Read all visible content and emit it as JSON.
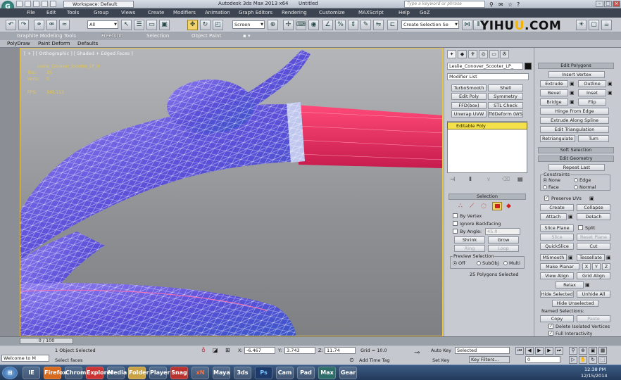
{
  "titlebar": {
    "workspace": "Workspace: Default",
    "app_title": "Autodesk 3ds Max 2013 x64",
    "doc_title": "Untitled",
    "search_placeholder": "Type a keyword or phrase"
  },
  "menubar": {
    "items": [
      "File",
      "Edit",
      "Tools",
      "Group",
      "Views",
      "Create",
      "Modifiers",
      "Animation",
      "Graph Editors",
      "Rendering",
      "Customize",
      "MAXScript",
      "Help",
      "GoZ"
    ]
  },
  "toolbar": {
    "selection_filter": "All",
    "ref_coord": "Screen",
    "named_selection": "Create Selection Se"
  },
  "watermark": {
    "text_a": "YI",
    "text_b": "HU",
    "text_c": "U",
    "text_d": ".COM"
  },
  "ribbon": {
    "tabs": [
      "Graphite Modeling Tools",
      "Freeform",
      "Selection",
      "Object Paint"
    ],
    "sub_tabs": [
      "PolyDraw",
      "Paint Deform",
      "Defaults"
    ]
  },
  "viewport": {
    "label": "[ + ] [ Orthographic ] [ Shaded + Edged Faces ]",
    "stats": {
      "object": "Leslie_Conover_Scooter_LP_H",
      "tris_label": "Tris:",
      "tris": "25",
      "verts_label": "Verts:",
      "verts": "0",
      "fps_label": "FPS:",
      "fps": "345.113"
    }
  },
  "command_panel": {
    "object_name": "Leslie_Conover_Scooter_LP_",
    "modifier_list": "Modifier List",
    "modifier_buttons": [
      "TurboSmooth",
      "Shell",
      "Edit Poly",
      "Symmetry",
      "FFD(box)",
      "STL Check",
      "Unwrap UVW",
      "ffdDeform (WS"
    ],
    "stack_item": "Editable Poly",
    "selection_header": "Selection",
    "by_vertex": "By Vertex",
    "ignore_backfacing": "Ignore Backfacing",
    "by_angle": "By Angle:",
    "angle_value": "45.0",
    "shrink": "Shrink",
    "grow": "Grow",
    "ring": "Ring",
    "loop": "Loop",
    "preview_selection": "Preview Selection",
    "preview_off": "Off",
    "preview_subobj": "SubObj",
    "preview_multi": "Multi",
    "selected_info": "25 Polygons Selected"
  },
  "rollout": {
    "edit_polygons": "Edit Polygons",
    "insert_vertex": "Insert Vertex",
    "extrude": "Extrude",
    "outline": "Outline",
    "bevel": "Bevel",
    "inset": "Inset",
    "bridge": "Bridge",
    "flip": "Flip",
    "hinge_from_edge": "Hinge From Edge",
    "extrude_along_spline": "Extrude Along Spline",
    "edit_triangulation": "Edit Triangulation",
    "retriangulate": "Retriangulate",
    "turn": "Turn",
    "soft_selection": "Soft Selection",
    "edit_geometry": "Edit Geometry",
    "repeat_last": "Repeat Last",
    "constraints": "Constraints",
    "c_none": "None",
    "c_edge": "Edge",
    "c_face": "Face",
    "c_normal": "Normal",
    "preserve_uvs": "Preserve UVs",
    "create": "Create",
    "collapse": "Collapse",
    "attach": "Attach",
    "detach": "Detach",
    "slice_plane": "Slice Plane",
    "split": "Split",
    "reset_plane": "Reset Plane",
    "slice": "Slice",
    "quickslice": "QuickSlice",
    "cut": "Cut",
    "msmooth": "MSmooth",
    "tessellate": "Tessellate",
    "make_planar": "Make Planar",
    "x": "X",
    "y": "Y",
    "z": "Z",
    "view_align": "View Align",
    "grid_align": "Grid Align",
    "relax": "Relax",
    "hide_selected": "Hide Selected",
    "unhide_all": "Unhide All",
    "hide_unselected": "Hide Unselected",
    "named_selections": "Named Selections:",
    "copy": "Copy",
    "paste": "Paste",
    "delete_isolated": "Delete Isolated Vertices",
    "full_interactivity": "Full Interactivity"
  },
  "timeline": {
    "frame": "0 / 100"
  },
  "statusbar": {
    "welcome": "Welcome to M",
    "selected": "1 Object Selected",
    "prompt": "Select faces",
    "x_label": "X:",
    "x": "-6.467",
    "y_label": "Y:",
    "y": "3.743",
    "z_label": "Z:",
    "z": "11.74",
    "grid": "Grid = 10.0",
    "add_time_tag": "Add Time Tag",
    "auto_key": "Auto Key",
    "set_key": "Set Key",
    "key_mode": "Selected",
    "key_filters": "Key Filters...",
    "frame": "0",
    "clock_time": "12:38 PM",
    "clock_date": "12/15/2014"
  },
  "taskbar": {
    "apps": [
      "IE",
      "Firefox",
      "Chrome",
      "Explorer",
      "Media",
      "Folder",
      "Player",
      "Snag",
      "xN",
      "Maya",
      "3ds",
      "Ps",
      "Cam",
      "Pad",
      "Max",
      "Gear"
    ]
  }
}
